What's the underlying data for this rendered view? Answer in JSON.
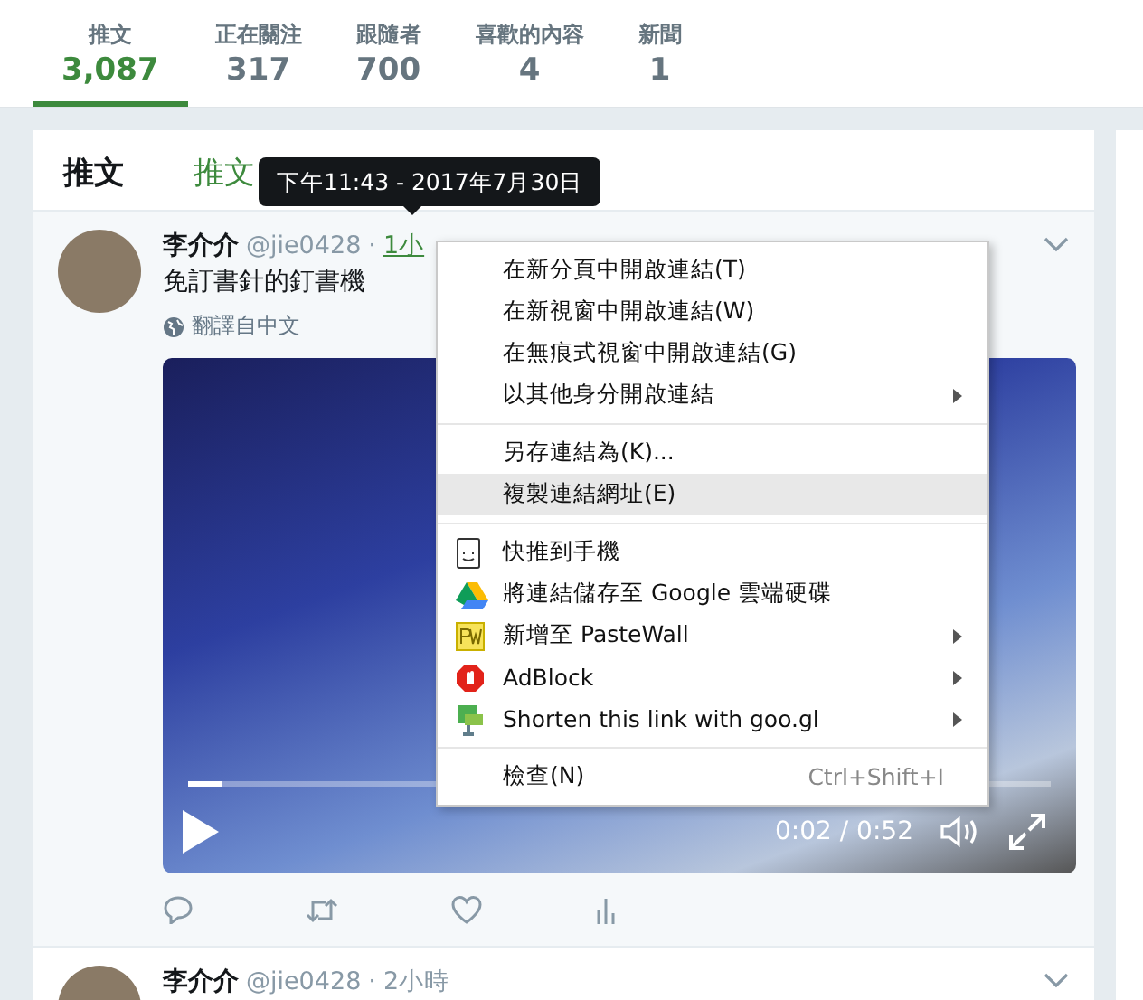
{
  "profile_nav": {
    "stats": [
      {
        "label": "推文",
        "value": "3,087",
        "selected": true
      },
      {
        "label": "正在關注",
        "value": "317",
        "selected": false
      },
      {
        "label": "跟隨者",
        "value": "700",
        "selected": false
      },
      {
        "label": "喜歡的內容",
        "value": "4",
        "selected": false
      },
      {
        "label": "新聞",
        "value": "1",
        "selected": false
      }
    ]
  },
  "timeline": {
    "tabs": [
      {
        "label": "推文",
        "selected": true
      },
      {
        "label": "推文",
        "selected": false
      }
    ],
    "tweets": [
      {
        "name": "李介介",
        "handle": "@jie0428",
        "separator": "·",
        "time": "1小",
        "time_hovered": true,
        "text": "免訂書針的釘書機",
        "translate": "翻譯自中文",
        "video": {
          "level": 0.04,
          "elapsed": "0:02 / 0:52"
        }
      },
      {
        "name": "李介介",
        "handle": "@jie0428",
        "separator": "·",
        "time": "2小時",
        "time_hovered": false
      }
    ]
  },
  "tooltip": {
    "text": "下午11:43 - 2017年7月30日"
  },
  "context_menu": {
    "items": [
      {
        "kind": "plain",
        "label": "在新分頁中開啟連結(T)",
        "submenu": false,
        "selected": false
      },
      {
        "kind": "plain",
        "label": "在新視窗中開啟連結(W)",
        "submenu": false,
        "selected": false
      },
      {
        "kind": "plain",
        "label": "在無痕式視窗中開啟連結(G)",
        "submenu": false,
        "selected": false
      },
      {
        "kind": "plain",
        "label": "以其他身分開啟連結",
        "submenu": true,
        "selected": false
      },
      {
        "kind": "separator"
      },
      {
        "kind": "plain",
        "label": "另存連結為(K)...",
        "submenu": false,
        "selected": false
      },
      {
        "kind": "plain",
        "label": "複製連結網址(E)",
        "submenu": false,
        "selected": true
      },
      {
        "kind": "separator"
      },
      {
        "kind": "phone",
        "label": "快推到手機",
        "submenu": false,
        "selected": false
      },
      {
        "kind": "drive",
        "label": "將連結儲存至 Google 雲端硬碟",
        "submenu": false,
        "selected": false
      },
      {
        "kind": "pastewall",
        "label": "新增至 PasteWall",
        "submenu": true,
        "selected": false
      },
      {
        "kind": "adblock",
        "label": "AdBlock",
        "submenu": true,
        "selected": false
      },
      {
        "kind": "shorten",
        "label": "Shorten this link with goo.gl",
        "submenu": true,
        "selected": false
      },
      {
        "kind": "separator"
      },
      {
        "kind": "plain",
        "label": "檢查(N)",
        "submenu": false,
        "selected": false,
        "shortcut": "Ctrl+Shift+I"
      }
    ]
  }
}
